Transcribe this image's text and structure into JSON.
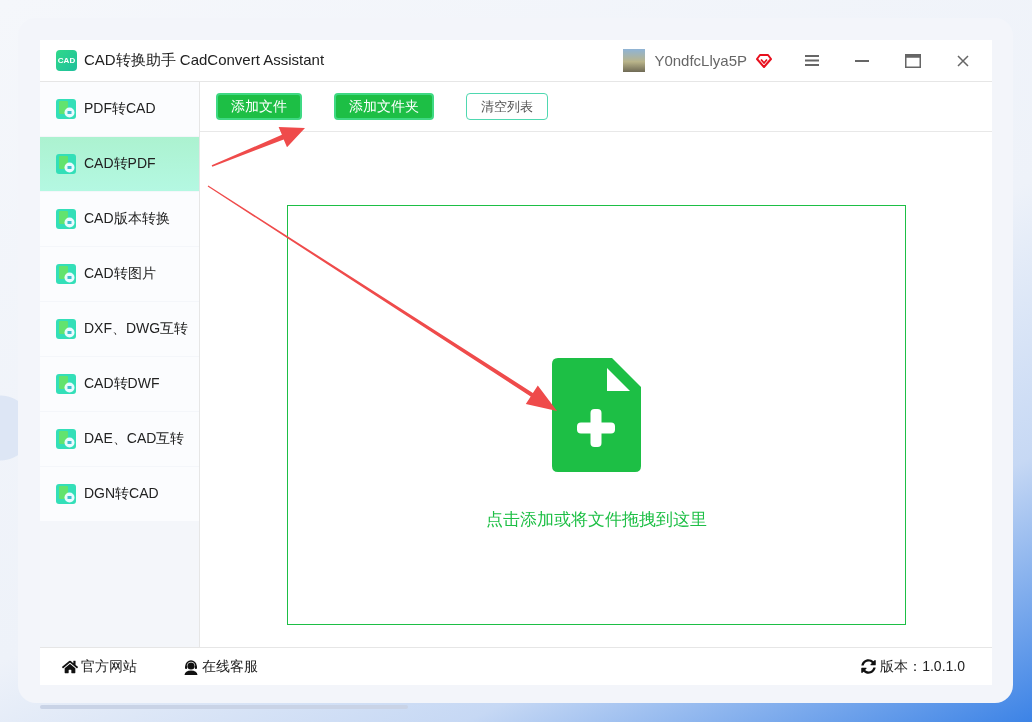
{
  "window": {
    "logo_text": "CAD",
    "title": "CAD转换助手 CadConvert Assistant",
    "user": {
      "name": "Y0ndfcLlya5P"
    }
  },
  "toolbar": {
    "buttons": [
      {
        "label": "添加文件",
        "kind": "primary"
      },
      {
        "label": "添加文件夹",
        "kind": "primary"
      },
      {
        "label": "清空列表",
        "kind": "outline"
      }
    ]
  },
  "sidebar": {
    "items": [
      {
        "label": "PDF转CAD",
        "selected": false
      },
      {
        "label": "CAD转PDF",
        "selected": true
      },
      {
        "label": "CAD版本转换",
        "selected": false
      },
      {
        "label": "CAD转图片",
        "selected": false
      },
      {
        "label": "DXF、DWG互转",
        "selected": false
      },
      {
        "label": "CAD转DWF",
        "selected": false
      },
      {
        "label": "DAE、CAD互转",
        "selected": false
      },
      {
        "label": "DGN转CAD",
        "selected": false
      }
    ]
  },
  "drop_zone": {
    "hint": "点击添加或将文件拖拽到这里"
  },
  "footer": {
    "links": [
      {
        "label": "官方网站",
        "kind": "home"
      },
      {
        "label": "在线客服",
        "kind": "support"
      }
    ],
    "version": "版本：1.0.1.0"
  }
}
